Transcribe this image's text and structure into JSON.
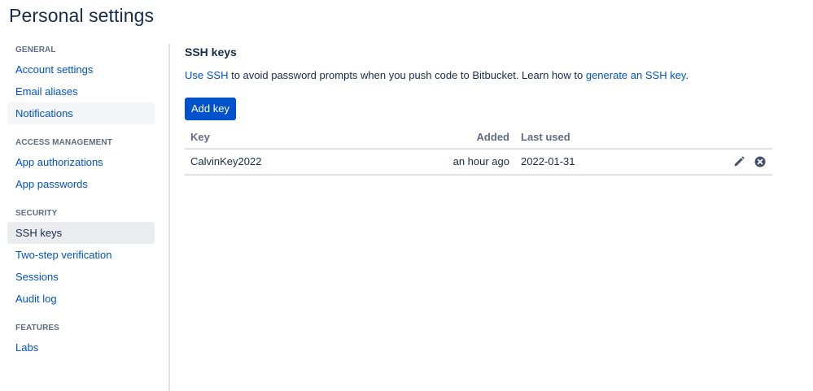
{
  "page": {
    "title": "Personal settings"
  },
  "sidebar": {
    "groups": [
      {
        "heading": "GENERAL",
        "items": [
          {
            "label": "Account settings"
          },
          {
            "label": "Email aliases"
          },
          {
            "label": "Notifications"
          }
        ]
      },
      {
        "heading": "ACCESS MANAGEMENT",
        "items": [
          {
            "label": "App authorizations"
          },
          {
            "label": "App passwords"
          }
        ]
      },
      {
        "heading": "SECURITY",
        "items": [
          {
            "label": "SSH keys"
          },
          {
            "label": "Two-step verification"
          },
          {
            "label": "Sessions"
          },
          {
            "label": "Audit log"
          }
        ]
      },
      {
        "heading": "FEATURES",
        "items": [
          {
            "label": "Labs"
          }
        ]
      }
    ]
  },
  "main": {
    "title": "SSH keys",
    "description": {
      "link1": "Use SSH",
      "text1": " to avoid password prompts when you push code to Bitbucket. Learn how to ",
      "link2": "generate an SSH key",
      "text2": "."
    },
    "add_button_label": "Add key",
    "table": {
      "headers": {
        "key": "Key",
        "added": "Added",
        "last_used": "Last used"
      },
      "rows": [
        {
          "key": "CalvinKey2022",
          "added": "an hour ago",
          "last_used": "2022-01-31"
        }
      ]
    }
  },
  "icons": {
    "edit": "pencil-icon",
    "delete": "close-circle-icon"
  },
  "colors": {
    "link": "#0052cc",
    "primary": "#0052cc",
    "text": "#172b4d",
    "muted": "#5e6c84",
    "border": "#dfe1e6"
  }
}
